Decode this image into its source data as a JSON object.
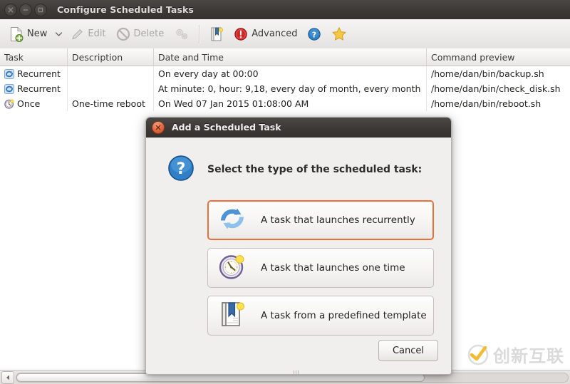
{
  "window": {
    "title": "Configure Scheduled Tasks",
    "controls": [
      {
        "name": "close-window-button",
        "glyph": "close-icon"
      },
      {
        "name": "minimize-window-button",
        "glyph": "minimize-icon"
      },
      {
        "name": "maximize-window-button",
        "glyph": "maximize-icon"
      }
    ]
  },
  "toolbar": {
    "new_label": "New",
    "new_icon": "new-document-icon",
    "new_dropdown_icon": "chevron-down-icon",
    "edit_label": "Edit",
    "edit_icon": "pencil-icon",
    "edit_enabled": false,
    "delete_label": "Delete",
    "delete_icon": "no-entry-icon",
    "delete_enabled": false,
    "gears_icon": "gears-icon",
    "gears_enabled": false,
    "template_icon": "bookmark-template-icon",
    "advanced_label": "Advanced",
    "advanced_icon": "alert-circle-icon",
    "help_icon": "help-circle-icon",
    "favorite_icon": "star-icon"
  },
  "table": {
    "columns": [
      "Task",
      "Description",
      "Date and Time",
      "Command preview"
    ],
    "rows": [
      {
        "icon": "recurrent-icon",
        "task": "Recurrent",
        "description": "",
        "datetime": "On every day at 00:00",
        "command": "/home/dan/bin/backup.sh"
      },
      {
        "icon": "recurrent-icon",
        "task": "Recurrent",
        "description": "",
        "datetime": "At minute: 0, hour: 9,18, every day of month, every month",
        "command": "/home/dan/bin/check_disk.sh"
      },
      {
        "icon": "once-clock-icon",
        "task": "Once",
        "description": "One-time reboot",
        "datetime": "On Wed 07 Jan 2015 01:08:00 AM",
        "command": "/home/dan/bin/reboot.sh"
      }
    ]
  },
  "scrollbar": {
    "left_arrow_icon": "triangle-left-icon"
  },
  "dialog": {
    "title": "Add a Scheduled Task",
    "close_icon": "close-icon",
    "prompt_icon": "question-circle-icon",
    "prompt": "Select the type of the scheduled task:",
    "options": [
      {
        "icon": "recurrent-arrows-icon",
        "label": "A task that launches recurrently",
        "focused": true
      },
      {
        "icon": "clock-icon",
        "label": "A task that launches one time",
        "focused": false
      },
      {
        "icon": "template-bookmark-icon",
        "label": "A task from a predefined template",
        "focused": false
      }
    ],
    "cancel_label": "Cancel"
  },
  "watermark": {
    "text": "创新互联",
    "logo_icon": "check-circle-logo"
  },
  "colors": {
    "titlebar": "#3c3936",
    "focus_orange": "#e8703a",
    "close_red": "#e2663c",
    "toolbar_bg": "#edecea",
    "dialog_bg": "#f0efed"
  }
}
